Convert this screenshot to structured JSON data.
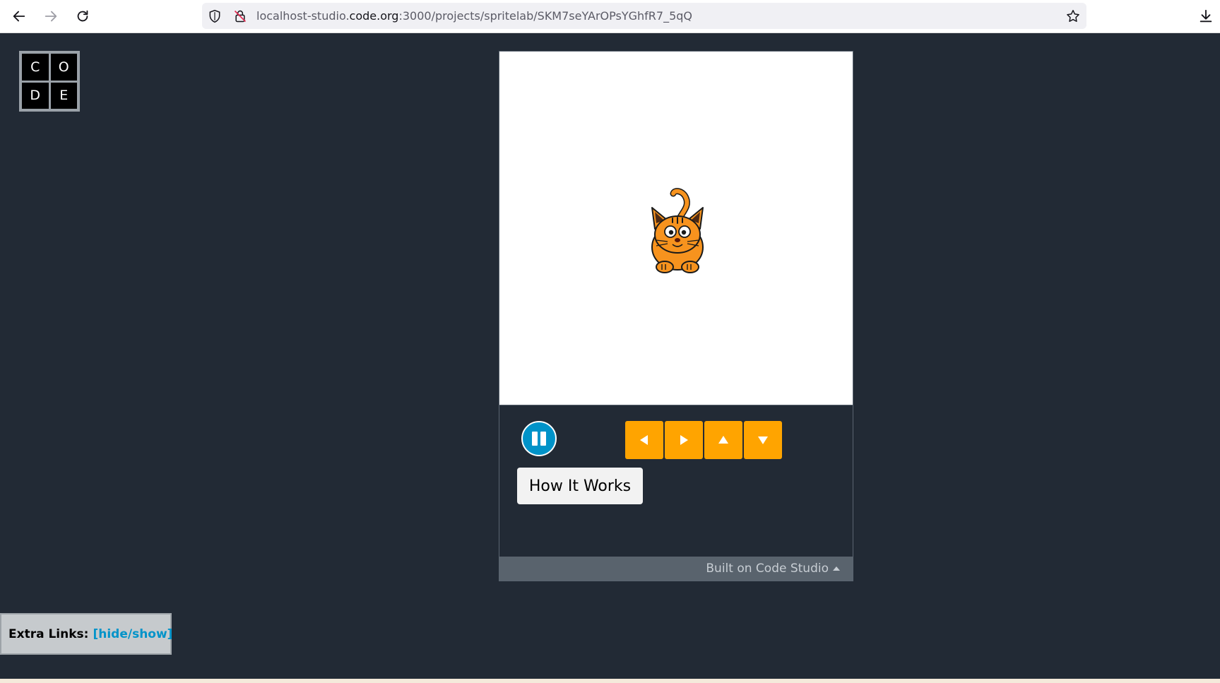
{
  "browser": {
    "url_host_prefix": "localhost-studio.",
    "url_host_domain": "code.org",
    "url_path": ":3000/projects/spritelab/SKM7seYArOPsYGhfR7_5qQ",
    "icons": [
      "back-icon",
      "forward-icon",
      "reload-icon",
      "shield-icon",
      "insecure-lock-icon",
      "bookmark-star-icon",
      "download-icon"
    ]
  },
  "logo": {
    "letters": [
      "C",
      "O",
      "D",
      "E"
    ]
  },
  "stage": {
    "background": "#ffffff",
    "sprite": "cat"
  },
  "controls": {
    "pause_icon": "pause-icon",
    "arrows": [
      "left-arrow-icon",
      "right-arrow-icon",
      "up-arrow-icon",
      "down-arrow-icon"
    ],
    "arrow_color": "#ffa400",
    "how_it_works_label": "How It Works",
    "footer_label": "Built on Code Studio"
  },
  "extra_links": {
    "label": "Extra Links:",
    "toggle": "[hide/show]"
  },
  "colors": {
    "page_bg": "#222a35",
    "accent_blue": "#0093c9",
    "footer_bg": "#59636d"
  }
}
